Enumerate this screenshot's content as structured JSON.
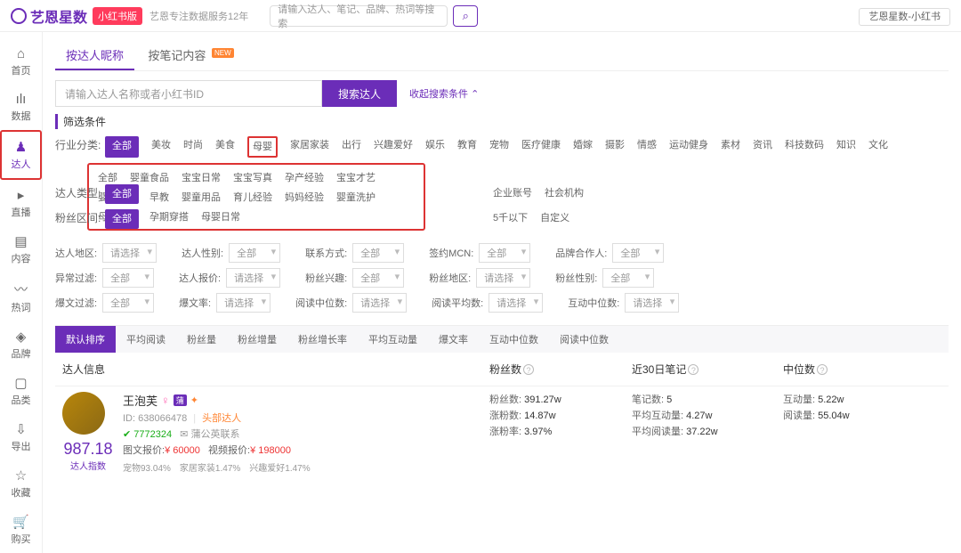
{
  "header": {
    "logo": "艺恩星数",
    "platform_badge": "小红书版",
    "slogan": "艺恩专注数据服务12年",
    "search_placeholder": "请输入达人、笔记、品牌、热词等搜索",
    "account_dropdown": "艺恩星数-小红书"
  },
  "sidebar": [
    {
      "icon": "⌂",
      "label": "首页"
    },
    {
      "icon": "ılı",
      "label": "数据"
    },
    {
      "icon": "♟",
      "label": "达人",
      "active": true
    },
    {
      "icon": "▸",
      "label": "直播"
    },
    {
      "icon": "▤",
      "label": "内容"
    },
    {
      "icon": "〰",
      "label": "热词"
    },
    {
      "icon": "◈",
      "label": "品牌"
    },
    {
      "icon": "▢",
      "label": "品类"
    },
    {
      "icon": "⇩",
      "label": "导出"
    },
    {
      "icon": "☆",
      "label": "收藏"
    },
    {
      "icon": "🛒",
      "label": "购买"
    }
  ],
  "tabs": {
    "t1": "按达人昵称",
    "t2": "按笔记内容",
    "new": "NEW"
  },
  "search": {
    "placeholder": "请输入达人名称或者小红书ID",
    "button": "搜索达人",
    "collapse": "收起搜索条件"
  },
  "filters": {
    "title": "筛选条件",
    "industry_label": "行业分类:",
    "industry": [
      "全部",
      "美妆",
      "时尚",
      "美食",
      "母婴",
      "家居家装",
      "出行",
      "兴趣爱好",
      "娱乐",
      "教育",
      "宠物",
      "医疗健康",
      "婚嫁",
      "摄影",
      "情感",
      "运动健身",
      "素材",
      "资讯",
      "科技数码",
      "知识",
      "文化"
    ],
    "sub_industry": [
      "全部",
      "婴童食品",
      "宝宝日常",
      "宝宝写真",
      "孕产经验",
      "宝宝才艺",
      "婴童时尚",
      "早教",
      "婴童用品",
      "育儿经验",
      "妈妈经验",
      "婴童洗护",
      "母婴其他",
      "孕期穿搭",
      "母婴日常"
    ],
    "type_label": "达人类型:",
    "type": [
      "全部",
      "企业账号",
      "社会机构"
    ],
    "fans_label": "粉丝区间:",
    "fans": [
      "全部",
      "5千以下",
      "自定义"
    ],
    "selects_row1": [
      {
        "label": "达人地区:",
        "value": "请选择"
      },
      {
        "label": "达人性别:",
        "value": "全部"
      },
      {
        "label": "联系方式:",
        "value": "全部"
      },
      {
        "label": "签约MCN:",
        "value": "全部"
      },
      {
        "label": "品牌合作人:",
        "value": "全部"
      }
    ],
    "selects_row2": [
      {
        "label": "异常过滤:",
        "value": "全部"
      },
      {
        "label": "达人报价:",
        "value": "请选择"
      },
      {
        "label": "粉丝兴趣:",
        "value": "全部"
      },
      {
        "label": "粉丝地区:",
        "value": "请选择"
      },
      {
        "label": "粉丝性别:",
        "value": "全部"
      }
    ],
    "selects_row3": [
      {
        "label": "爆文过滤:",
        "value": "全部"
      },
      {
        "label": "爆文率:",
        "value": "请选择"
      },
      {
        "label": "阅读中位数:",
        "value": "请选择"
      },
      {
        "label": "阅读平均数:",
        "value": "请选择"
      },
      {
        "label": "互动中位数:",
        "value": "请选择"
      }
    ]
  },
  "sort": [
    "默认排序",
    "平均阅读",
    "粉丝量",
    "粉丝增量",
    "粉丝增长率",
    "平均互动量",
    "爆文率",
    "互动中位数",
    "阅读中位数"
  ],
  "columns": {
    "info": "达人信息",
    "fans": "粉丝数",
    "notes": "近30日笔记",
    "median": "中位数"
  },
  "result": {
    "name": "王泡芙",
    "female_icon": "♀",
    "id_label": "ID:",
    "id": "638066478",
    "head_tag": "头部达人",
    "fans_num": "7772324",
    "contact": "蒲公英联系",
    "price_img_label": "图文报价:",
    "price_img": "¥ 60000",
    "price_video_label": "视频报价:",
    "price_video": "¥ 198000",
    "score": "987.18",
    "score_label": "达人指数",
    "domains": [
      {
        "name": "宠物",
        "pct": "93.04%"
      },
      {
        "name": "家居家装",
        "pct": "1.47%"
      },
      {
        "name": "兴趣爱好",
        "pct": "1.47%"
      }
    ],
    "fans_stats": [
      {
        "k": "粉丝数:",
        "v": "391.27w"
      },
      {
        "k": "涨粉数:",
        "v": "14.87w"
      },
      {
        "k": "涨粉率:",
        "v": "3.97%"
      }
    ],
    "note_stats": [
      {
        "k": "笔记数:",
        "v": "5"
      },
      {
        "k": "平均互动量:",
        "v": "4.27w"
      },
      {
        "k": "平均阅读量:",
        "v": "37.22w"
      }
    ],
    "median_stats": [
      {
        "k": "互动量:",
        "v": "5.22w"
      },
      {
        "k": "阅读量:",
        "v": "55.04w"
      }
    ]
  }
}
